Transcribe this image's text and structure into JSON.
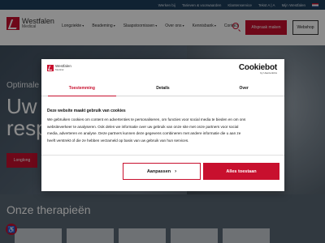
{
  "topbar": {
    "links": [
      "Werken bij",
      "Tarieven & voorwaarden",
      "Klantenservice",
      "Tekst  A | A",
      "Mijn Westfalen"
    ],
    "flag": "netherlands-flag"
  },
  "header": {
    "logo_name": "Westfalen",
    "logo_sub": "Medical",
    "nav": [
      "Longziekte",
      "Beademing",
      "Slaapstoornissen",
      "Over ons",
      "Kennisbank",
      "Contact"
    ],
    "appointment_label": "Afspraak maken",
    "webshop_label": "Webshop"
  },
  "hero": {
    "eyebrow": "Optimale",
    "title_line1": "Uw s",
    "title_line2": "respi",
    "button_label": "Longlong"
  },
  "therapies": {
    "title": "Onze therapieën"
  },
  "cookie_dialog": {
    "logo_name": "Westfalen",
    "logo_sub": "Medical",
    "brand_name": "Cookiebot",
    "brand_sub": "by Usercentrics",
    "tabs": [
      "Toestemming",
      "Details",
      "Over"
    ],
    "active_tab": "Toestemming",
    "heading": "Deze website maakt gebruik van cookies",
    "body_lines": [
      "We gebruiken cookies om content en advertenties te personaliseren, om functies voor social media te bieden en om ons",
      "websiteverkeer te analyseren. Ook delen we informatie over uw gebruik van onze site met onze partners voor social",
      "media, adverteren en analyse. Deze partners kunnen deze gegevens combineren met andere informatie die u aan ze",
      "heeft verstrekt of die ze hebben verzameld op basis van uw gebruik van hun services."
    ],
    "customize_label": "Aanpassen",
    "allow_all_label": "Alles toestaan"
  },
  "colors": {
    "brand_red": "#c8102e",
    "topbar_navy": "#1e3e5c"
  }
}
